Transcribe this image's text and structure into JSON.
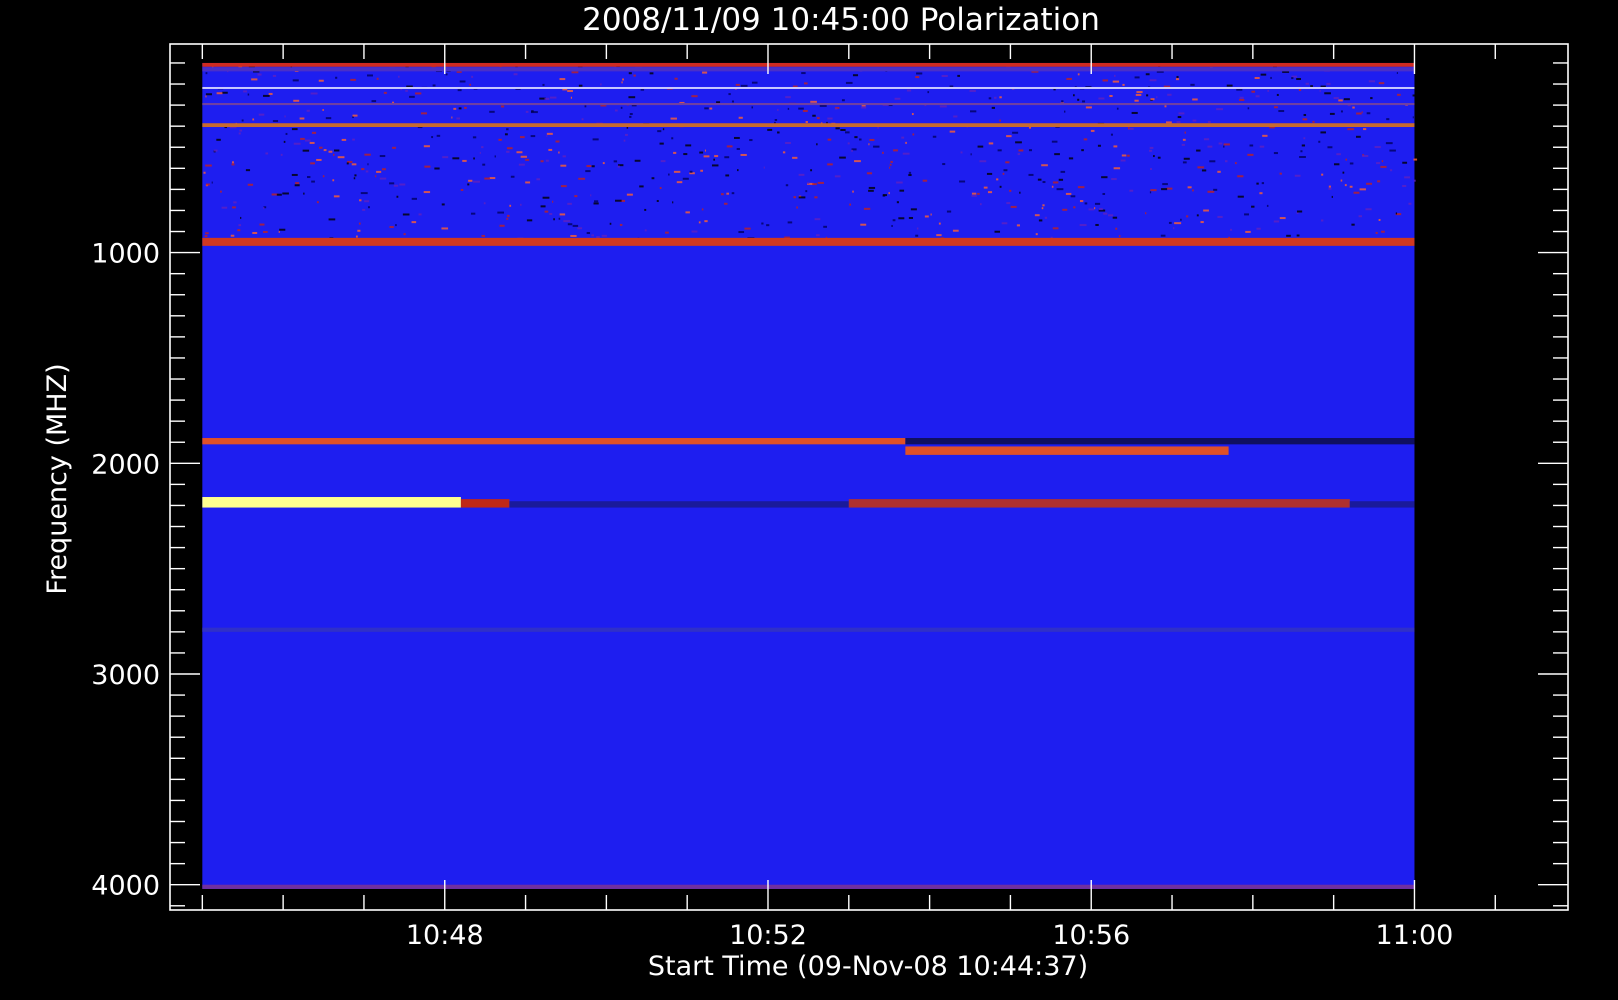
{
  "chart_data": {
    "type": "heatmap",
    "title": "2008/11/09 10:45:00 Polarization",
    "xlabel": "Start Time (09-Nov-08 10:44:37)",
    "ylabel": "Frequency (MHZ)",
    "x_axis": {
      "range_minutes": [
        44.6,
        61.9
      ],
      "data_range_minutes": [
        45.0,
        60.0
      ],
      "major_ticks": [
        {
          "minute": 48,
          "label": "10:48"
        },
        {
          "minute": 52,
          "label": "10:52"
        },
        {
          "minute": 56,
          "label": "10:56"
        },
        {
          "minute": 60,
          "label": "11:00"
        }
      ],
      "minor_tick_step_minutes": 1
    },
    "y_axis": {
      "range": [
        4120,
        10
      ],
      "data_range": [
        4020,
        100
      ],
      "inverted": true,
      "major_ticks": [
        1000,
        2000,
        3000,
        4000
      ],
      "minor_tick_step": 100
    },
    "background_color": "#1e1ef0",
    "colormap": [
      "#000000",
      "#0000ff",
      "#ff0000",
      "#ffff00",
      "#ffffff"
    ],
    "bands": [
      {
        "freq": [
          100,
          118
        ],
        "color": "#d02a20",
        "start": 45.0,
        "end": 60.0
      },
      {
        "freq": [
          120,
          140
        ],
        "color": "#4a30c8",
        "start": 45.0,
        "end": 60.0
      },
      {
        "freq": [
          214,
          222
        ],
        "color": "#c8c8ff",
        "start": 45.0,
        "end": 60.0
      },
      {
        "freq": [
          290,
          300
        ],
        "color": "#7040a0",
        "start": 45.0,
        "end": 60.0
      },
      {
        "freq": [
          386,
          404
        ],
        "color": "#c86a30",
        "start": 45.0,
        "end": 60.0
      },
      {
        "freq": [
          930,
          968
        ],
        "color": "#d03820",
        "start": 45.0,
        "end": 60.0
      },
      {
        "freq": [
          1880,
          1910
        ],
        "color": "#e05028",
        "start": 45.0,
        "end": 53.7
      },
      {
        "freq": [
          1880,
          1910
        ],
        "color": "#101060",
        "start": 53.7,
        "end": 60.0
      },
      {
        "freq": [
          1920,
          1960
        ],
        "color": "#e05028",
        "start": 53.7,
        "end": 57.7
      },
      {
        "freq": [
          2160,
          2210
        ],
        "color": "#ffff90",
        "start": 45.0,
        "end": 48.2
      },
      {
        "freq": [
          2170,
          2210
        ],
        "color": "#c02818",
        "start": 48.2,
        "end": 48.8
      },
      {
        "freq": [
          2180,
          2210
        ],
        "color": "#1a1a9a",
        "start": 48.8,
        "end": 53.0
      },
      {
        "freq": [
          2170,
          2210
        ],
        "color": "#b03030",
        "start": 53.0,
        "end": 59.2
      },
      {
        "freq": [
          2180,
          2210
        ],
        "color": "#1a1a9a",
        "start": 59.2,
        "end": 60.0
      },
      {
        "freq": [
          2780,
          2800
        ],
        "color": "#3030c8",
        "start": 45.0,
        "end": 60.0
      },
      {
        "freq": [
          4000,
          4020
        ],
        "color": "#7030a0",
        "start": 45.0,
        "end": 60.0
      }
    ]
  }
}
